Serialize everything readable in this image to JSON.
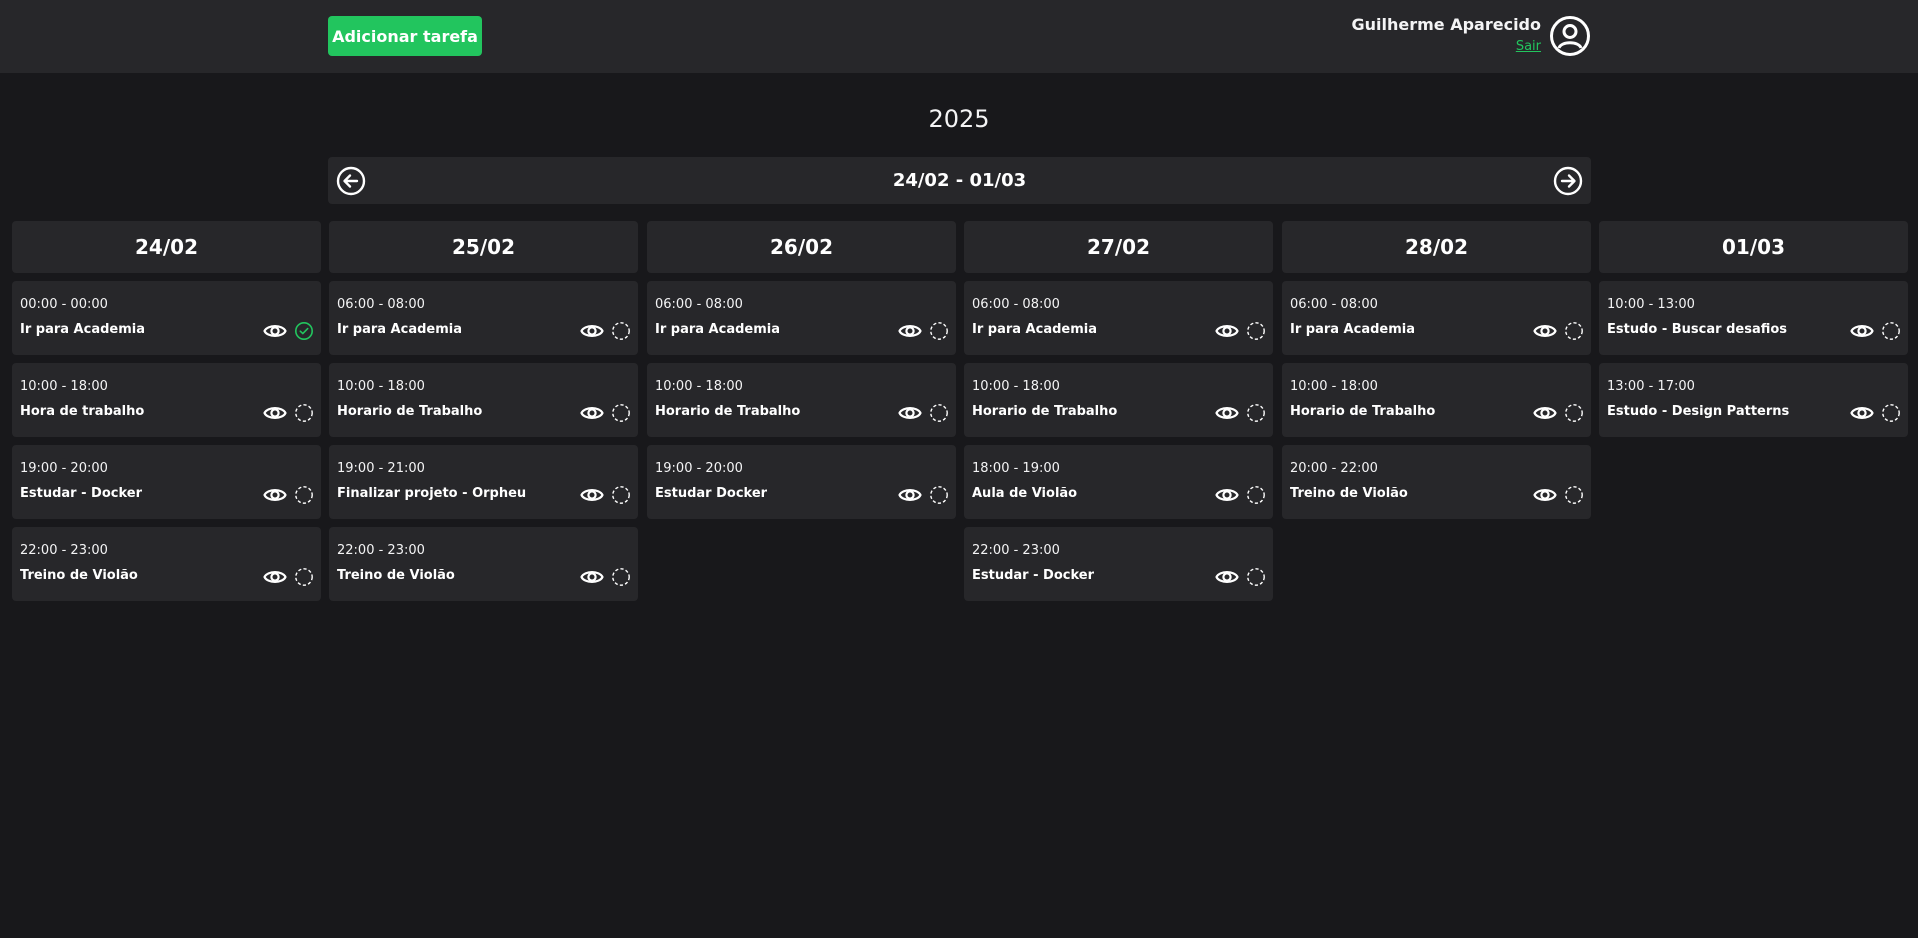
{
  "header": {
    "add_task_label": "Adicionar tarefa",
    "user_name": "Guilherme Aparecido",
    "logout_label": "Sair"
  },
  "year": "2025",
  "week_range": "24/02 - 01/03",
  "colors": {
    "accent": "#22c55e",
    "background": "#18181b",
    "surface": "#27272a"
  },
  "days": [
    {
      "date": "24/02",
      "tasks": [
        {
          "time": "00:00 - 00:00",
          "title": "Ir para Academia",
          "done": true
        },
        {
          "time": "10:00 - 18:00",
          "title": "Hora de trabalho",
          "done": false
        },
        {
          "time": "19:00 - 20:00",
          "title": "Estudar - Docker",
          "done": false
        },
        {
          "time": "22:00 - 23:00",
          "title": "Treino de Violão",
          "done": false
        }
      ]
    },
    {
      "date": "25/02",
      "tasks": [
        {
          "time": "06:00 - 08:00",
          "title": "Ir para Academia",
          "done": false
        },
        {
          "time": "10:00 - 18:00",
          "title": "Horario de Trabalho",
          "done": false
        },
        {
          "time": "19:00 - 21:00",
          "title": "Finalizar projeto - Orpheu",
          "done": false
        },
        {
          "time": "22:00 - 23:00",
          "title": "Treino de Violão",
          "done": false
        }
      ]
    },
    {
      "date": "26/02",
      "tasks": [
        {
          "time": "06:00 - 08:00",
          "title": "Ir para Academia",
          "done": false
        },
        {
          "time": "10:00 - 18:00",
          "title": "Horario de Trabalho",
          "done": false
        },
        {
          "time": "19:00 - 20:00",
          "title": "Estudar Docker",
          "done": false
        }
      ]
    },
    {
      "date": "27/02",
      "tasks": [
        {
          "time": "06:00 - 08:00",
          "title": "Ir para Academia",
          "done": false
        },
        {
          "time": "10:00 - 18:00",
          "title": "Horario de Trabalho",
          "done": false
        },
        {
          "time": "18:00 - 19:00",
          "title": "Aula de Violão",
          "done": false
        },
        {
          "time": "22:00 - 23:00",
          "title": "Estudar - Docker",
          "done": false
        }
      ]
    },
    {
      "date": "28/02",
      "tasks": [
        {
          "time": "06:00 - 08:00",
          "title": "Ir para Academia",
          "done": false
        },
        {
          "time": "10:00 - 18:00",
          "title": "Horario de Trabalho",
          "done": false
        },
        {
          "time": "20:00 - 22:00",
          "title": "Treino de Violão",
          "done": false
        }
      ]
    },
    {
      "date": "01/03",
      "tasks": [
        {
          "time": "10:00 - 13:00",
          "title": "Estudo - Buscar desafios",
          "done": false
        },
        {
          "time": "13:00 - 17:00",
          "title": "Estudo - Design Patterns",
          "done": false
        }
      ]
    }
  ]
}
